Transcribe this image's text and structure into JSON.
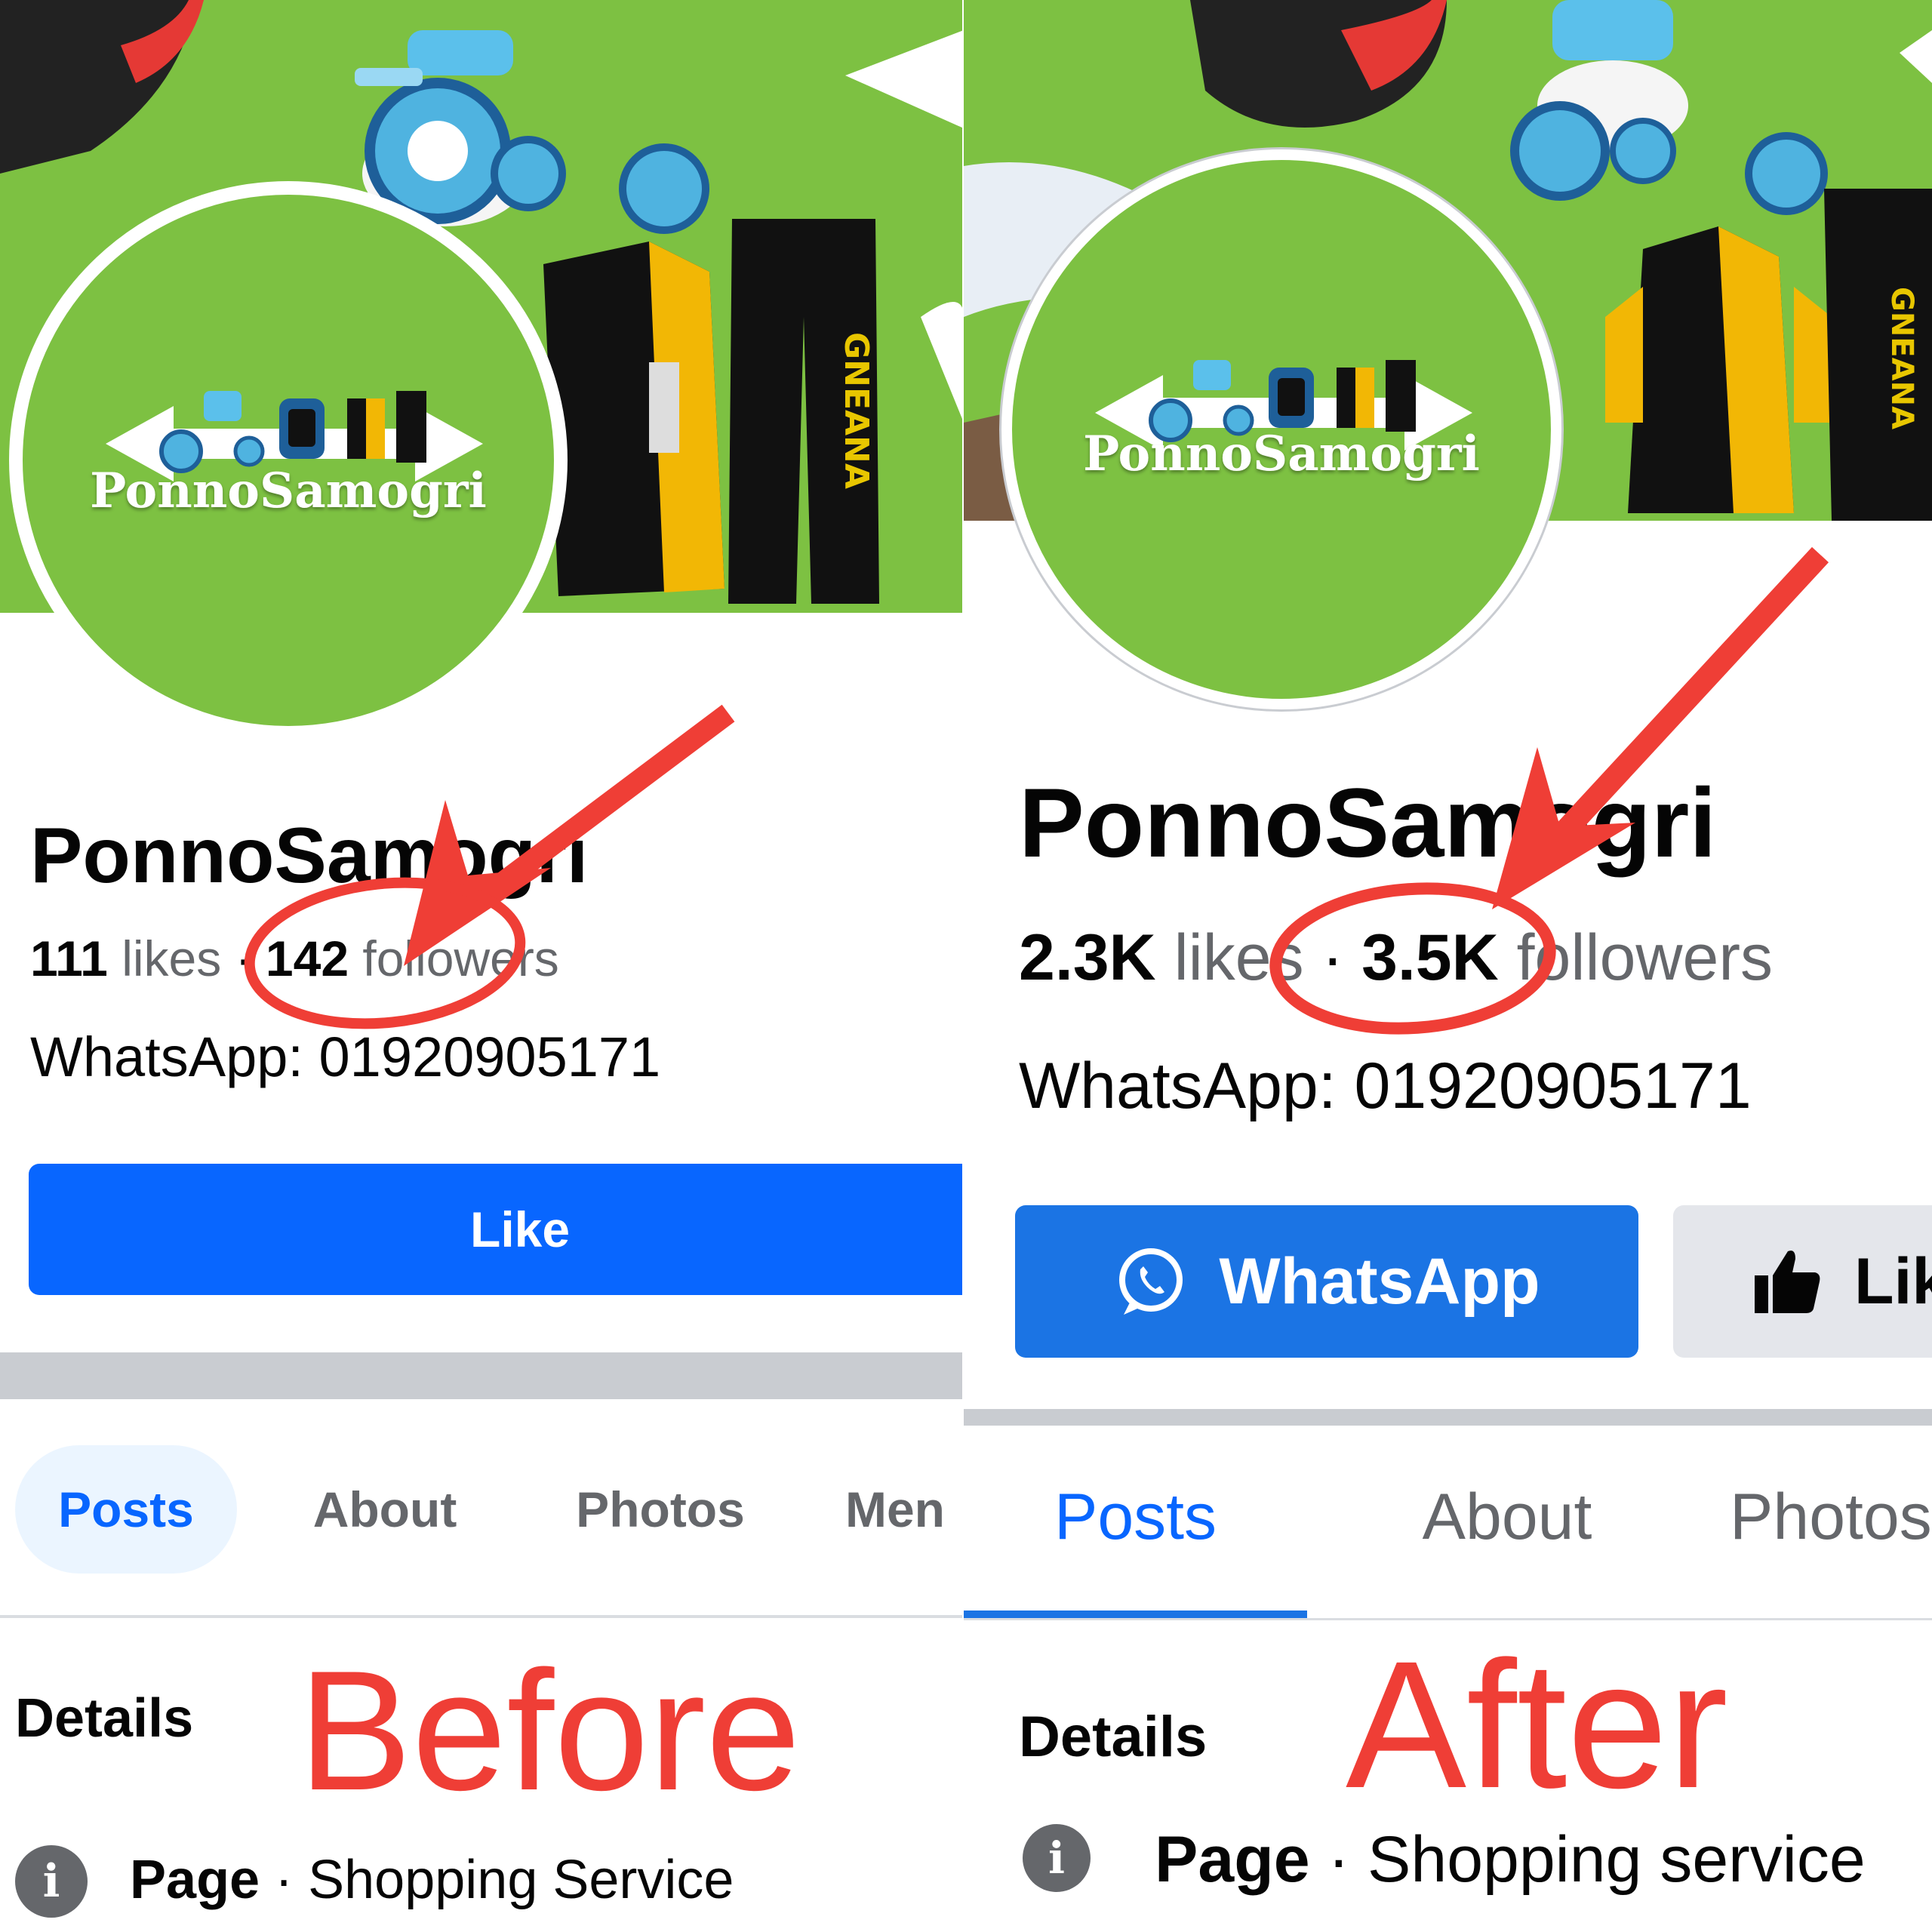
{
  "before": {
    "page_name": "PonnoSamogri",
    "logo_text": "PonnoSamogri",
    "likes_count": "111",
    "likes_label": "likes",
    "followers_count": "142",
    "followers_label": "followers",
    "separator": "·",
    "contact": "WhatsApp: 01920905171",
    "like_button": "Like",
    "tabs": [
      "Posts",
      "About",
      "Photos",
      "Men"
    ],
    "details_label": "Details",
    "caption": "Before",
    "category_label": "Page",
    "category_sep": " · ",
    "category_value": "Shopping Service",
    "info_icon": "i"
  },
  "after": {
    "page_name": "PonnoSamogri",
    "logo_text": "PonnoSamogri",
    "likes_count": "2.3K",
    "likes_label": "likes",
    "followers_count": "3.5K",
    "followers_label": "followers",
    "separator": "·",
    "contact": "WhatsApp: 01920905171",
    "whatsapp_button": "WhatsApp",
    "like_button": "Lik",
    "tabs": [
      "Posts",
      "About",
      "Photos"
    ],
    "details_label": "Details",
    "caption": "After",
    "category_label": "Page",
    "category_sep": " · ",
    "category_value": "Shopping service",
    "info_icon": "i"
  },
  "icons": {
    "whatsapp": "whatsapp-icon",
    "thumbs_up": "thumbs-up-icon",
    "info": "info-icon"
  },
  "colors": {
    "brand_green": "#7dc142",
    "facebook_blue": "#0866ff",
    "annotation_red": "#ef3e36"
  }
}
